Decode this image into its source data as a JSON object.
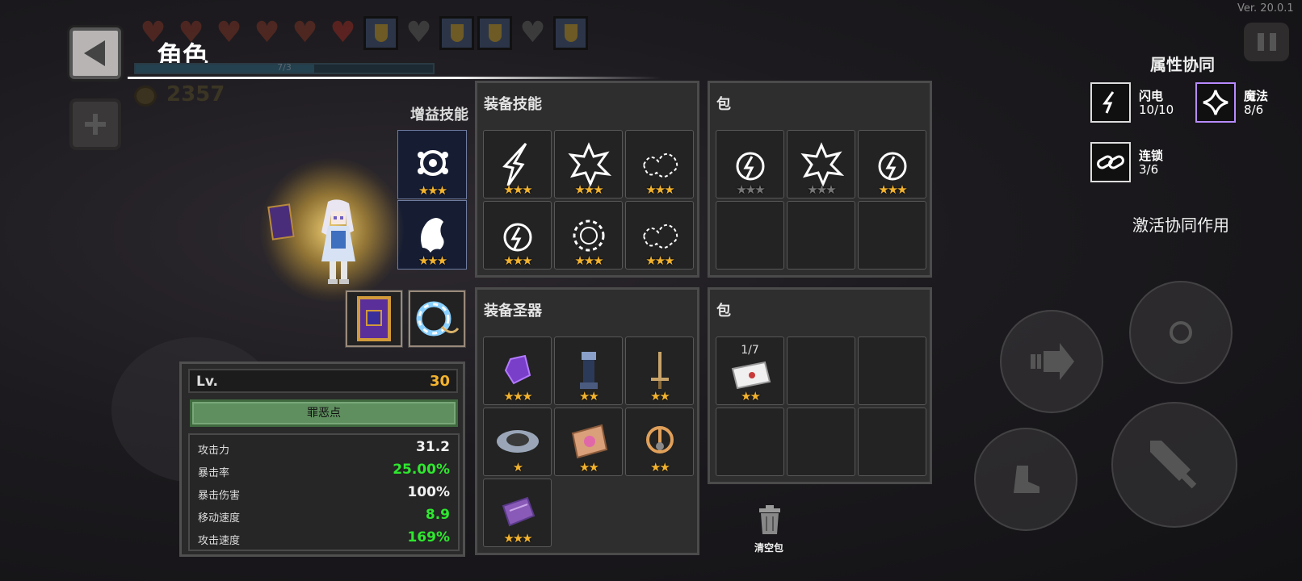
{
  "version": "Ver. 20.0.1",
  "header": {
    "title": "角色",
    "xp_text": "7/3",
    "coins": "2357",
    "hearts": [
      "full",
      "full",
      "full",
      "full",
      "full",
      "full",
      "shield",
      "grey",
      "shield",
      "shield",
      "grey",
      "shield"
    ]
  },
  "buff_skills": {
    "title": "增益技能",
    "slots": [
      {
        "icon": "mask-skill-icon",
        "stars": 3
      },
      {
        "icon": "ghost-skill-icon",
        "stars": 3
      }
    ]
  },
  "equipped_skills": {
    "title": "装备技能",
    "cells": [
      {
        "icon": "lightning-strike-icon",
        "stars": 3
      },
      {
        "icon": "explosion-icon",
        "stars": 3
      },
      {
        "icon": "chain-burst-icon",
        "stars": 3
      },
      {
        "icon": "lightning-orb-icon",
        "stars": 3
      },
      {
        "icon": "spiral-burst-icon",
        "stars": 3
      },
      {
        "icon": "chain-burst-icon",
        "stars": 3
      }
    ]
  },
  "bag_skills": {
    "title": "包",
    "cells": [
      {
        "icon": "lightning-orb-icon",
        "stars": 3,
        "lit": 1
      },
      {
        "icon": "explosion-icon",
        "stars": 3,
        "lit": 0
      },
      {
        "icon": "lightning-orb-icon",
        "stars": 3,
        "lit": 3
      }
    ]
  },
  "equipped_relics": {
    "title": "装备圣器",
    "cells": [
      {
        "icon": "purple-crystal-icon",
        "stars": 3
      },
      {
        "icon": "chess-rook-icon",
        "stars": 2
      },
      {
        "icon": "sword-icon",
        "stars": 2
      },
      {
        "icon": "cloud-stone-icon",
        "stars": 1
      },
      {
        "icon": "magic-scroll-icon",
        "stars": 2
      },
      {
        "icon": "peace-amulet-icon",
        "stars": 2
      },
      {
        "icon": "purple-book-icon",
        "stars": 3
      }
    ]
  },
  "bag_relics": {
    "title": "包",
    "cells": [
      {
        "icon": "envelope-icon",
        "stars": 2,
        "count": "1/7"
      }
    ]
  },
  "stats": {
    "lv_label": "Lv.",
    "lv_value": "30",
    "sin_button": "罪恶点",
    "rows": [
      {
        "name": "攻击力",
        "value": "31.2",
        "highlight": false
      },
      {
        "name": "暴击率",
        "value": "25.00%",
        "highlight": true
      },
      {
        "name": "暴击伤害",
        "value": "100%",
        "highlight": false
      },
      {
        "name": "移动速度",
        "value": "8.9",
        "highlight": true
      },
      {
        "name": "攻击速度",
        "value": "169%",
        "highlight": true
      }
    ]
  },
  "synergy": {
    "title": "属性协同",
    "items": [
      {
        "name": "闪电",
        "count": "10/10",
        "icon": "lightning-icon"
      },
      {
        "name": "魔法",
        "count": "8/6",
        "icon": "magic-star-icon"
      },
      {
        "name": "连锁",
        "count": "3/6",
        "icon": "chain-icon"
      }
    ],
    "activate_label": "激活协同作用"
  },
  "trash_label": "清空包",
  "colors": {
    "star": "#f3b32e",
    "green_stat": "#2ee82e",
    "level": "#f3b32e"
  }
}
